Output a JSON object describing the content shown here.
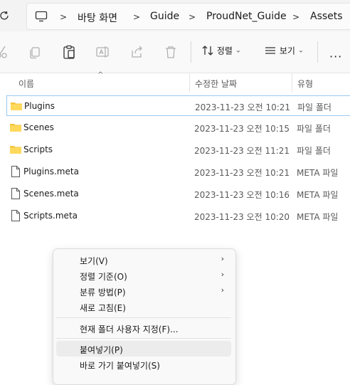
{
  "address": {
    "crumbs": [
      "바탕 화면",
      "Guide",
      "ProudNet_Guide",
      "Assets"
    ],
    "separator": ">"
  },
  "toolbar": {
    "sort_label": "정렬",
    "view_label": "보기",
    "more_label": "···",
    "dropdown_caret": "⌄"
  },
  "columns": {
    "name": "이름",
    "modified": "수정한 날짜",
    "type": "유형",
    "sort_caret": "^"
  },
  "files": [
    {
      "name": "Plugins",
      "modified": "2023-11-23 오전 10:21",
      "type": "파일 폴더",
      "icon": "folder-icon"
    },
    {
      "name": "Scenes",
      "modified": "2023-11-23 오전 10:15",
      "type": "파일 폴더",
      "icon": "folder-icon"
    },
    {
      "name": "Scripts",
      "modified": "2023-11-23 오전 11:21",
      "type": "파일 폴더",
      "icon": "folder-icon"
    },
    {
      "name": "Plugins.meta",
      "modified": "2023-11-23 오전 10:21",
      "type": "META 파일",
      "icon": "file-icon"
    },
    {
      "name": "Scenes.meta",
      "modified": "2023-11-23 오전 10:16",
      "type": "META 파일",
      "icon": "file-icon"
    },
    {
      "name": "Scripts.meta",
      "modified": "2023-11-23 오전 10:20",
      "type": "META 파일",
      "icon": "file-icon"
    }
  ],
  "context_menu": {
    "items": [
      {
        "label": "보기(V)",
        "submenu": true
      },
      {
        "label": "정렬 기준(O)",
        "submenu": true
      },
      {
        "label": "분류 방법(P)",
        "submenu": true
      },
      {
        "label": "새로 고침(E)",
        "submenu": false
      },
      {
        "label": "현재 폴더 사용자 지정(F)...",
        "submenu": false
      },
      {
        "label": "붙여넣기(P)",
        "submenu": false
      },
      {
        "label": "바로 가기 붙여넣기(S)",
        "submenu": false
      }
    ],
    "submenu_arrow": "›"
  },
  "colors": {
    "folder": "#f4c542",
    "selection_border": "#99c8f0",
    "menu_hover": "#ececec"
  }
}
